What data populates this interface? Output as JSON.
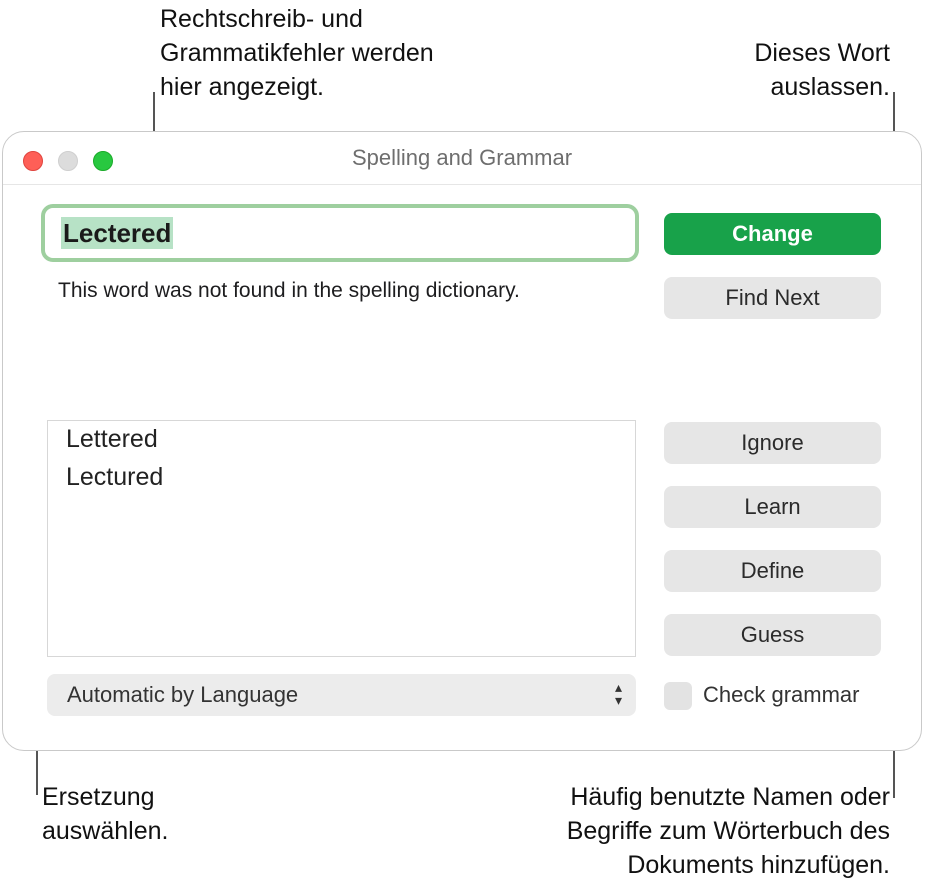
{
  "callouts": {
    "spelling_errors": "Rechtschreib- und\nGrammatikfehler werden\nhier angezeigt.",
    "ignore_word": "Dieses Wort\nauslassen.",
    "choose_replacement": "Ersetzung\nauswählen.",
    "learn_word": "Häufig benutzte Namen oder\nBegriffe zum Wörterbuch des\nDokuments hinzufügen."
  },
  "window": {
    "title": "Spelling and Grammar",
    "misspelled_word": "Lectered",
    "message": "This word was not found in the spelling dictionary.",
    "buttons": {
      "change": "Change",
      "find_next": "Find Next",
      "ignore": "Ignore",
      "learn": "Learn",
      "define": "Define",
      "guess": "Guess"
    },
    "suggestions": [
      "Lettered",
      "Lectured"
    ],
    "language_select": "Automatic by Language",
    "check_grammar_label": "Check grammar",
    "check_grammar_checked": false
  },
  "colors": {
    "accent": "#18a24a",
    "field_focus": "#9ecf9f",
    "close": "#fe5f57",
    "zoom": "#28c840"
  }
}
